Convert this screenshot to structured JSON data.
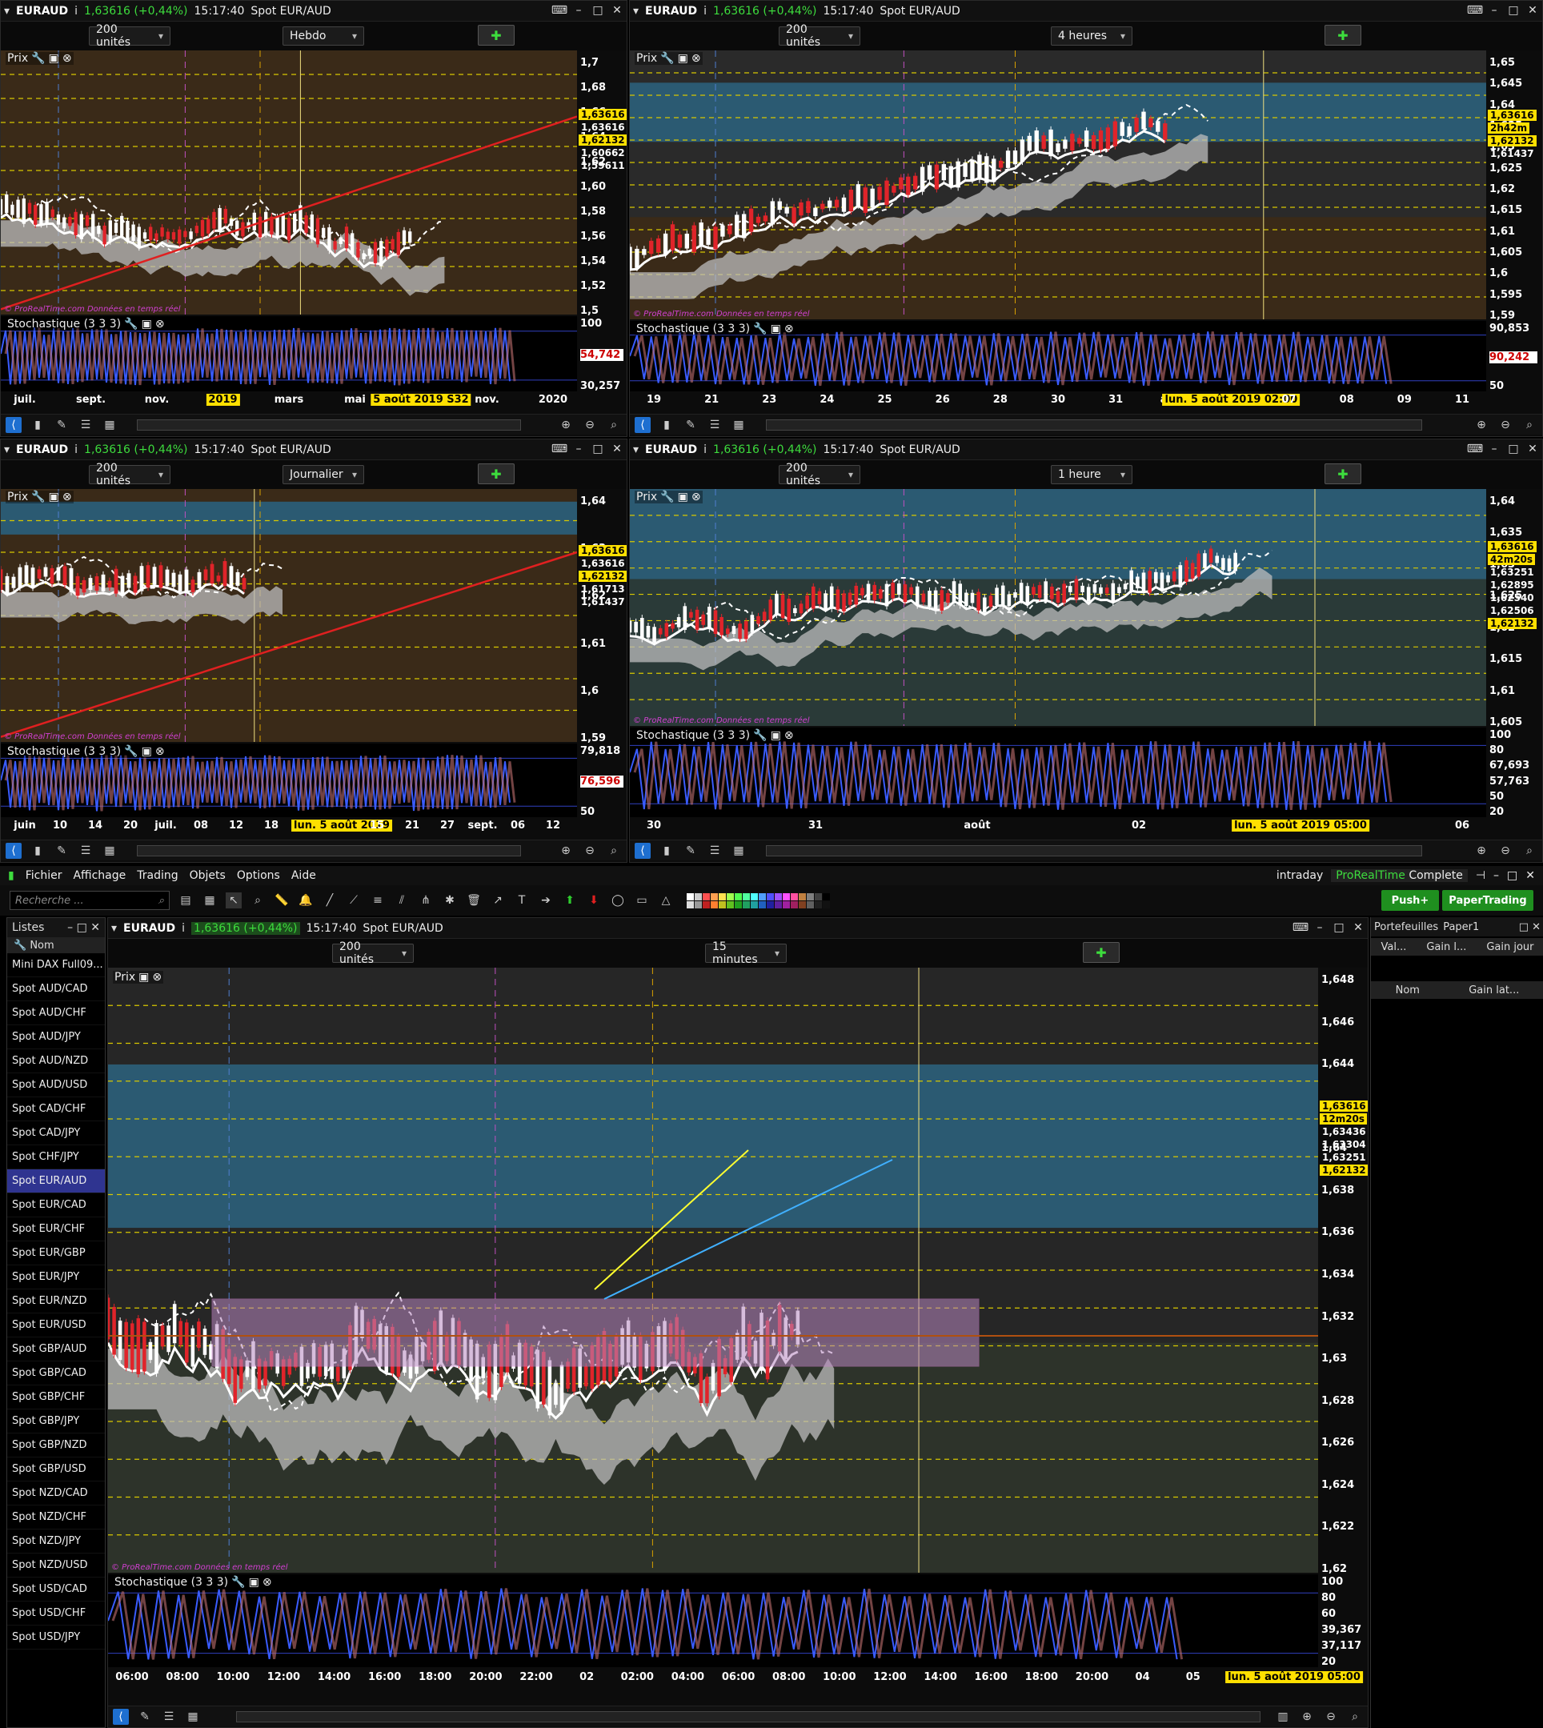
{
  "header": {
    "symbol": "EURAUD",
    "price_change": "1,63616 (+0,44%)",
    "time": "15:17:40",
    "instrument": "Spot EUR/AUD",
    "dropdown": "▾"
  },
  "units": "200 unités",
  "panels": [
    {
      "id": "p1",
      "timeframe": "Hebdo",
      "price_label": "Prix",
      "stoch_label": "Stochastique (3 3 3)",
      "yticks": [
        "1,7",
        "1,68",
        "1,66",
        "1,64",
        "1,62",
        "1,60",
        "1,58",
        "1,56",
        "1,54",
        "1,52",
        "1,5"
      ],
      "tags": [
        {
          "t": "1,63616",
          "c": "y"
        },
        {
          "t": "1,63616",
          "c": "w"
        },
        {
          "t": "1,62132",
          "c": "y"
        },
        {
          "t": "1,60662",
          "c": "w"
        },
        {
          "t": "1,59611",
          "c": "w"
        }
      ],
      "stoch_ticks": [
        "100",
        "54,742",
        "30,257"
      ],
      "xticks": [
        "juil.",
        "sept.",
        "nov.",
        "2019",
        "mars",
        "mai",
        "5 août 2019 S32",
        "nov.",
        "2020"
      ]
    },
    {
      "id": "p2",
      "timeframe": "4 heures",
      "price_label": "Prix",
      "stoch_label": "Stochastique (3 3 3)",
      "yticks": [
        "1,65",
        "1,645",
        "1,64",
        "1,635",
        "1,63",
        "1,625",
        "1,62",
        "1,615",
        "1,61",
        "1,605",
        "1,6",
        "1,595",
        "1,59"
      ],
      "tags": [
        {
          "t": "1,63616",
          "c": "y"
        },
        {
          "t": "2h42m",
          "c": "g"
        },
        {
          "t": "1,62132",
          "c": "y"
        },
        {
          "t": "1,61437",
          "c": "w"
        }
      ],
      "stoch_ticks": [
        "90,853",
        "90,242",
        "50"
      ],
      "xticks": [
        "19",
        "21",
        "23",
        "24",
        "25",
        "26",
        "28",
        "30",
        "31",
        "août",
        "lun. 5 août 2019 02:00",
        "07",
        "08",
        "09",
        "11"
      ]
    },
    {
      "id": "p3",
      "timeframe": "Journalier",
      "price_label": "Prix",
      "stoch_label": "Stochastique (3 3 3)",
      "yticks": [
        "1,64",
        "1,63",
        "1,62",
        "1,61",
        "1,6",
        "1,59"
      ],
      "tags": [
        {
          "t": "1,63616",
          "c": "y"
        },
        {
          "t": "1,63616",
          "c": "w"
        },
        {
          "t": "1,62132",
          "c": "y"
        },
        {
          "t": "1,61713",
          "c": "w"
        },
        {
          "t": "1,61437",
          "c": "w"
        }
      ],
      "stoch_ticks": [
        "79,818",
        "76,596",
        "50"
      ],
      "xticks": [
        "juin",
        "10",
        "14",
        "20",
        "juil.",
        "08",
        "12",
        "18",
        "24",
        "lun. 5 août 2019",
        "15",
        "21",
        "27",
        "sept.",
        "06",
        "12"
      ]
    },
    {
      "id": "p4",
      "timeframe": "1 heure",
      "price_label": "Prix",
      "stoch_label": "Stochastique (3 3 3)",
      "yticks": [
        "1,64",
        "1,635",
        "1,63",
        "1,625",
        "1,62",
        "1,615",
        "1,61",
        "1,605"
      ],
      "tags": [
        {
          "t": "1,63616",
          "c": "y"
        },
        {
          "t": "42m20s",
          "c": "g"
        },
        {
          "t": "1,63251",
          "c": "w"
        },
        {
          "t": "1,62895",
          "c": "w"
        },
        {
          "t": "1,62540",
          "c": "w"
        },
        {
          "t": "1,62506",
          "c": "w"
        },
        {
          "t": "1,62132",
          "c": "y"
        }
      ],
      "stoch_ticks": [
        "100",
        "80",
        "67,693",
        "57,763",
        "50",
        "20"
      ],
      "xticks": [
        "30",
        "31",
        "août",
        "02",
        "lun. 5 août 2019 05:00",
        "06"
      ]
    }
  ],
  "main_chart": {
    "timeframe": "15 minutes",
    "price_label": "Prix",
    "stoch_label": "Stochastique (3 3 3)",
    "yticks": [
      "1,648",
      "1,646",
      "1,644",
      "1,642",
      "1,64",
      "1,638",
      "1,636",
      "1,634",
      "1,632",
      "1,63",
      "1,628",
      "1,626",
      "1,624",
      "1,622",
      "1,62"
    ],
    "tags": [
      {
        "t": "1,63616",
        "c": "y"
      },
      {
        "t": "12m20s",
        "c": "g"
      },
      {
        "t": "1,63436",
        "c": "w"
      },
      {
        "t": "1,63304",
        "c": "w"
      },
      {
        "t": "1,63251",
        "c": "w"
      },
      {
        "t": "1,62132",
        "c": "y"
      }
    ],
    "stoch_ticks": [
      "100",
      "80",
      "60",
      "39,367",
      "37,117",
      "20"
    ],
    "xticks": [
      "06:00",
      "08:00",
      "10:00",
      "12:00",
      "14:00",
      "16:00",
      "18:00",
      "20:00",
      "22:00",
      "02",
      "02:00",
      "04:00",
      "06:00",
      "08:00",
      "10:00",
      "12:00",
      "14:00",
      "16:00",
      "18:00",
      "20:00",
      "04",
      "05",
      "02:00",
      "lun. 5 août 2019 05:00"
    ]
  },
  "watermark": "© ProRealTime.com  Données en temps réel",
  "menu": {
    "items": [
      "Fichier",
      "Affichage",
      "Trading",
      "Objets",
      "Options",
      "Aide"
    ],
    "intraday": "intraday",
    "brand": "ProRealTime",
    "edition": "Complete"
  },
  "search_placeholder": "Recherche ...",
  "push_label": "Push+",
  "paper_label": "PaperTrading",
  "watchlist": {
    "title": "Listes",
    "column": "Nom",
    "items": [
      "Mini DAX Full09...",
      "Spot AUD/CAD",
      "Spot AUD/CHF",
      "Spot AUD/JPY",
      "Spot AUD/NZD",
      "Spot AUD/USD",
      "Spot CAD/CHF",
      "Spot CAD/JPY",
      "Spot CHF/JPY",
      "Spot EUR/AUD",
      "Spot EUR/CAD",
      "Spot EUR/CHF",
      "Spot EUR/GBP",
      "Spot EUR/JPY",
      "Spot EUR/NZD",
      "Spot EUR/USD",
      "Spot GBP/AUD",
      "Spot GBP/CAD",
      "Spot GBP/CHF",
      "Spot GBP/JPY",
      "Spot GBP/NZD",
      "Spot GBP/USD",
      "Spot NZD/CAD",
      "Spot NZD/CHF",
      "Spot NZD/JPY",
      "Spot NZD/USD",
      "Spot USD/CAD",
      "Spot USD/CHF",
      "Spot USD/JPY"
    ],
    "active": "Spot EUR/AUD"
  },
  "portfolio": {
    "title1": "Portefeuilles",
    "title2": "Paper1",
    "cols1": [
      "Val...",
      "Gain l...",
      "Gain jour"
    ],
    "cols2": [
      "Nom",
      "Gain lat..."
    ]
  },
  "colors": {
    "accent_yellow": "#ffe000",
    "cloud_teal": "#2b5a72",
    "bull": "#ffffff",
    "bear": "#e0242a"
  }
}
